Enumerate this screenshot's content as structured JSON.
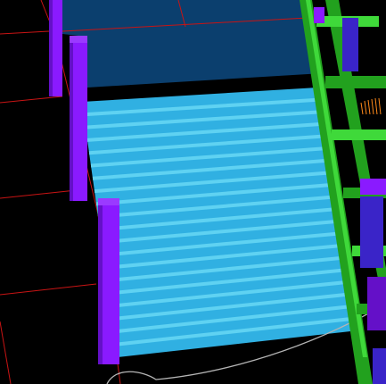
{
  "viewport": {
    "view": "3d-perspective",
    "background_color": "#000000",
    "show_grid": true
  },
  "colors": {
    "grid_line": "#c81414",
    "panel_dark": "#0b3f6e",
    "deck_light": "#30b0e2",
    "deck_stripe": "#5fd2f2",
    "post_purple": "#8a1aff",
    "post_purple_dark": "#6410c8",
    "ladder_green": "#22a11e",
    "ladder_green_light": "#3fd93a",
    "ladder_blue": "#3a24c8",
    "spark_orange": "#ff8a1a",
    "guide_curve": "#b4b4b4"
  },
  "scene_objects": [
    {
      "name": "dark-back-panel",
      "kind": "surface"
    },
    {
      "name": "striped-deck-panel",
      "kind": "surface"
    },
    {
      "name": "purple-post-1",
      "kind": "post"
    },
    {
      "name": "purple-post-2",
      "kind": "post"
    },
    {
      "name": "purple-post-3",
      "kind": "post"
    },
    {
      "name": "green-ladder-rail",
      "kind": "frame"
    },
    {
      "name": "guide-curve",
      "kind": "wire"
    }
  ]
}
